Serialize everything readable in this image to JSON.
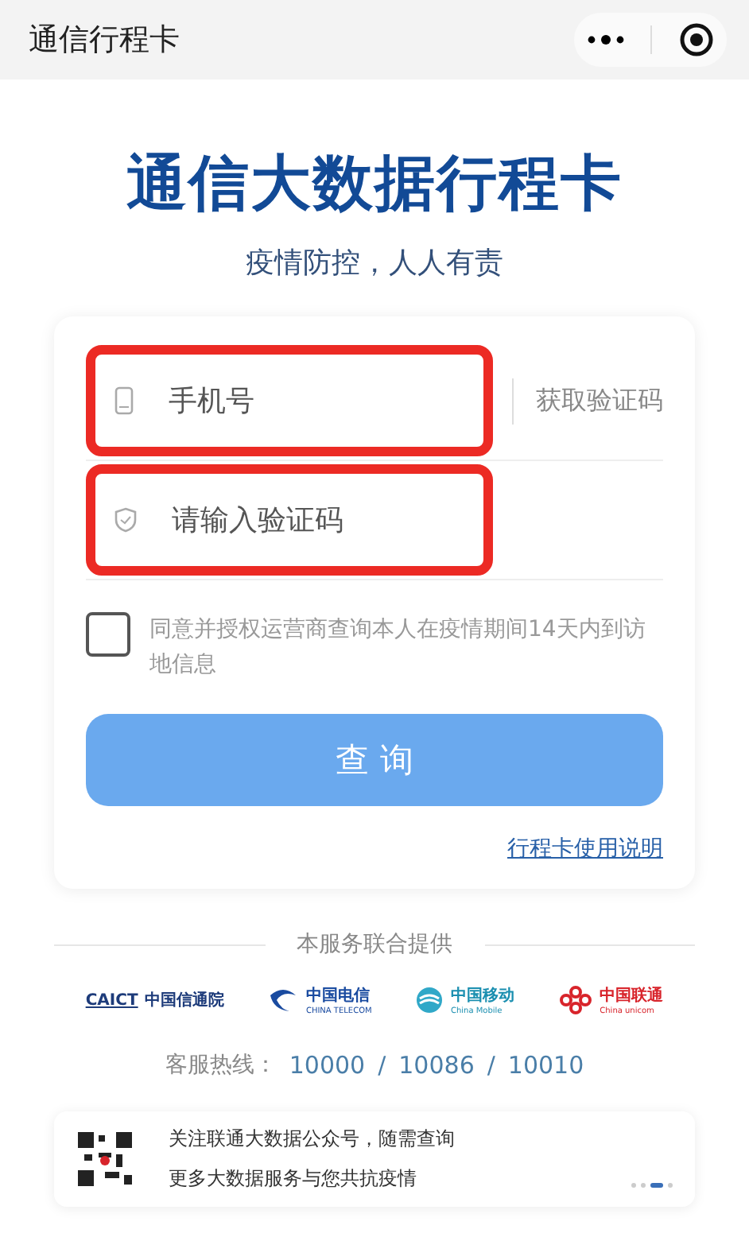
{
  "nav_bar": {
    "title": "通信行程卡"
  },
  "header": {
    "title": "通信大数据行程卡",
    "subtitle": "疫情防控，人人有责"
  },
  "form": {
    "phone": {
      "placeholder": "手机号",
      "highlighted": true
    },
    "get_code": "获取验证码",
    "code": {
      "placeholder": "请输入验证码",
      "highlighted": true
    },
    "consent": {
      "checked": false,
      "text": "同意并授权运营商查询本人在疫情期间14天内到访地信息"
    },
    "submit": "查 询",
    "help_link": "行程卡使用说明"
  },
  "providers": {
    "heading": "本服务联合提供",
    "logos": [
      {
        "kind": "caict",
        "name": "CAICT",
        "sub": "中国信通院"
      },
      {
        "kind": "telecom",
        "name": "中国电信",
        "sub": "CHINA TELECOM"
      },
      {
        "kind": "mobile",
        "name": "中国移动",
        "sub": "China Mobile"
      },
      {
        "kind": "unicom",
        "name": "中国联通",
        "sub": "China unicom"
      }
    ],
    "hotline_label": "客服热线：",
    "hotlines": [
      "10000",
      "10086",
      "10010"
    ],
    "separator": "/"
  },
  "banner": {
    "line1": "关注联通大数据公众号，随需查询",
    "line2": "更多大数据服务与您共抗疫情",
    "dots": [
      {
        "selected": false
      },
      {
        "selected": false
      },
      {
        "selected": true
      },
      {
        "selected": false
      }
    ]
  }
}
